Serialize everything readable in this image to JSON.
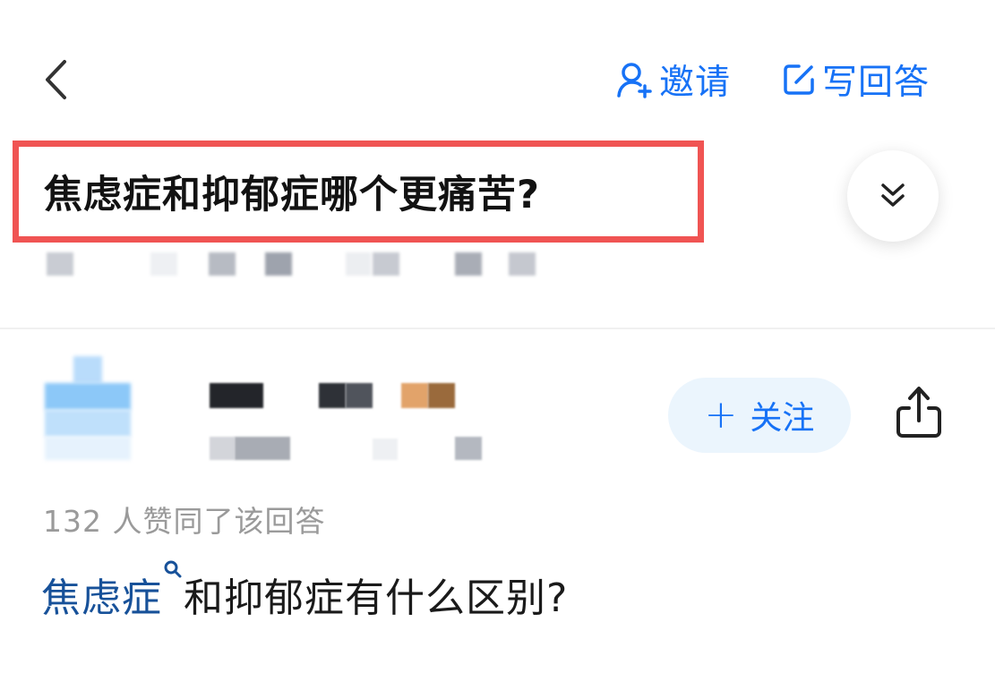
{
  "topbar": {
    "back_icon": "chevron-left-icon",
    "invite": {
      "icon": "add-user-icon",
      "label": "邀请"
    },
    "write_answer": {
      "icon": "edit-icon",
      "label": "写回答"
    }
  },
  "question": {
    "title": "焦虑症和抑郁症哪个更痛苦?",
    "expand_icon": "double-chevron-down-icon"
  },
  "answer": {
    "follow_label": "关注",
    "follow_icon": "plus-icon",
    "share_icon": "share-icon",
    "agree_text": "132 人赞同了该回答",
    "link_text": "焦虑症",
    "body_text": "和抑郁症有什么区别?"
  },
  "colors": {
    "accent": "#1772f6",
    "link": "#175199",
    "highlight_border": "#f05453",
    "muted_text": "#9a9a9a",
    "follow_bg": "#ebf5fd"
  }
}
